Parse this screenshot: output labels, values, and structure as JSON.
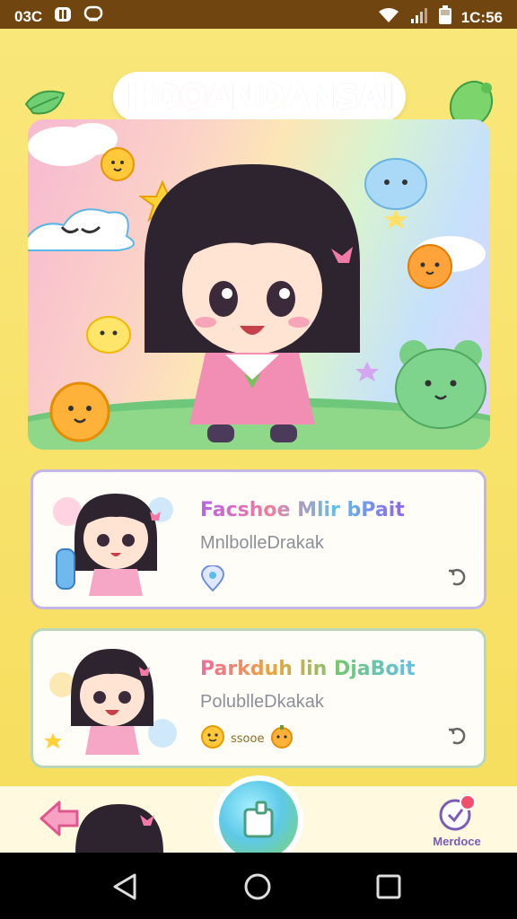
{
  "status_bar": {
    "left_time": "03C",
    "right_time": "1C:56",
    "icons": [
      "notification-icon",
      "chat-bubble-icon",
      "wifi-icon",
      "signal-icon",
      "battery-icon"
    ]
  },
  "app": {
    "title": "HDOANDANSAI",
    "cards": [
      {
        "title": "Facshoe Mlir bPait",
        "subtitle": "MnlbolleDrakak",
        "extra_icon": "location-pin-icon",
        "action_icon": "refresh-icon"
      },
      {
        "title": "Parkduh lin DjaBoit",
        "subtitle": "PolublleDkakak",
        "extra_label": "ssooe",
        "action_icon": "refresh-icon"
      }
    ],
    "bottom_nav": {
      "back_icon": "back-arrow-icon",
      "center_icon": "cup-icon",
      "right_label": "Merdoce",
      "right_icon": "notification-badge-icon"
    }
  },
  "system_nav": {
    "back": "back-triangle-icon",
    "home": "home-circle-icon",
    "recents": "recents-square-icon"
  },
  "colors": {
    "background": "#f7df63",
    "status_bar": "#70450f",
    "card_border_1": "#c4b6e4",
    "card_border_2": "#b9d6b9"
  }
}
